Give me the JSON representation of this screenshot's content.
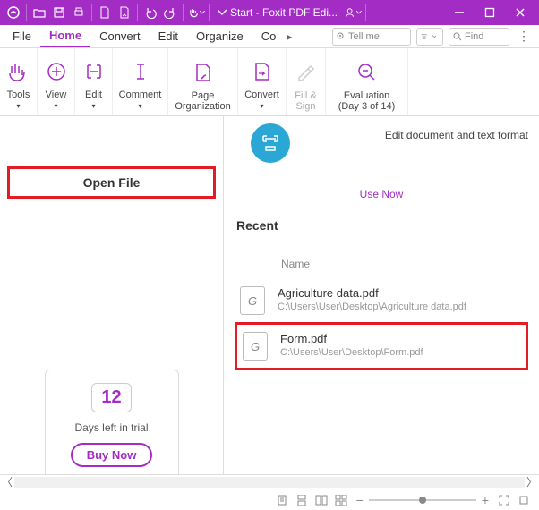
{
  "title": "Start - Foxit PDF Edi...",
  "tabs": {
    "file": "File",
    "home": "Home",
    "convert": "Convert",
    "edit": "Edit",
    "organize": "Organize",
    "co": "Co"
  },
  "search": {
    "tellme": "Tell me.",
    "find": "Find"
  },
  "ribbon": {
    "tools": "Tools",
    "view": "View",
    "edit": "Edit",
    "comment": "Comment",
    "page": "Page\nOrganization",
    "convert": "Convert",
    "fill": "Fill &\nSign",
    "eval": "Evaluation\n(Day 3 of 14)"
  },
  "left": {
    "open": "Open File",
    "days": "12",
    "daystxt": "Days left in trial",
    "buy": "Buy Now"
  },
  "right": {
    "editdoc": "Edit document and text format",
    "usenow": "Use Now",
    "recent": "Recent",
    "name": "Name",
    "files": [
      {
        "name": "Agriculture data.pdf",
        "path": "C:\\Users\\User\\Desktop\\Agriculture data.pdf"
      },
      {
        "name": "Form.pdf",
        "path": "C:\\Users\\User\\Desktop\\Form.pdf"
      }
    ]
  }
}
